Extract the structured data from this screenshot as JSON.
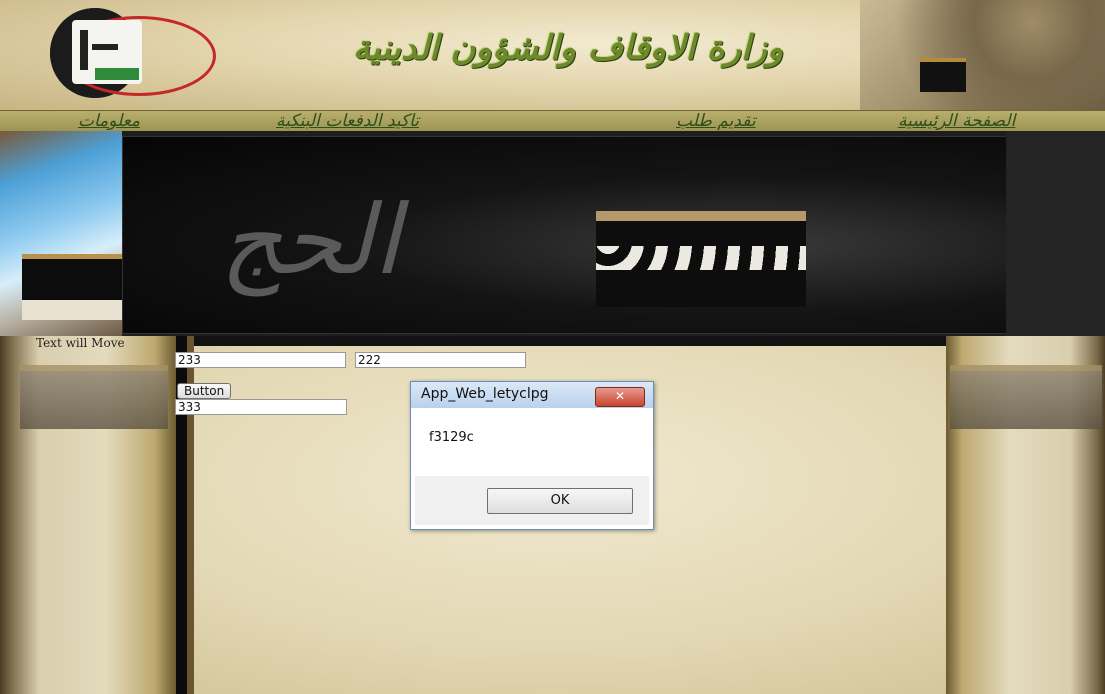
{
  "header": {
    "title": "وزارة الاوقاف والشؤون الدينية"
  },
  "nav": {
    "items": [
      {
        "label": "معلومات"
      },
      {
        "label": "تاكيد الدفعات البنكية"
      },
      {
        "label": "تقديم طلب"
      },
      {
        "label": "الصفحة الرئيسية"
      }
    ]
  },
  "banner": {
    "calligraphy": "الحج"
  },
  "page": {
    "marquee": "Text will Move"
  },
  "form": {
    "input_a": "233",
    "input_b": "222",
    "input_c": "333",
    "button_label": "Button"
  },
  "dialog": {
    "title": "App_Web_letyclpg",
    "close_label": "✕",
    "message": "f3129c",
    "ok_label": "OK"
  },
  "colors": {
    "title_green": "#6c8a2a",
    "nav_bar": "#b8ae6e",
    "dialog_close_red": "#c9442f"
  }
}
